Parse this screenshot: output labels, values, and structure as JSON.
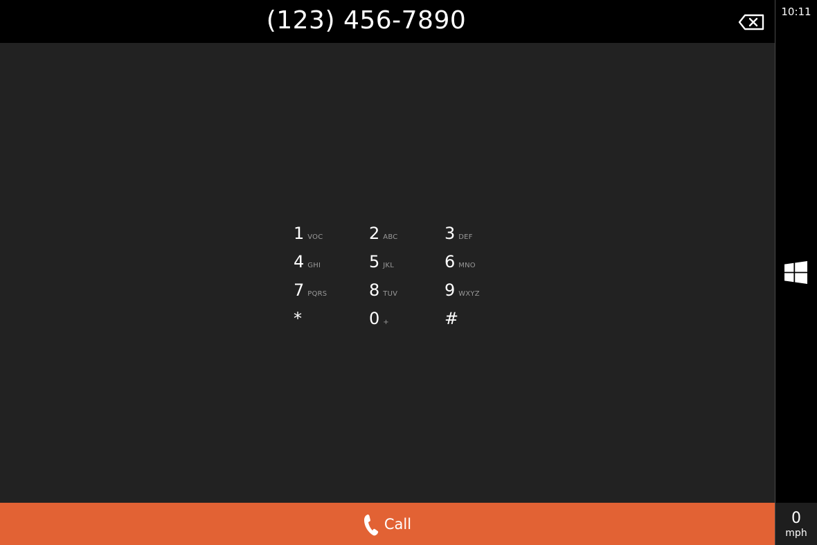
{
  "header": {
    "phone_number": "(123) 456-7890",
    "backspace_icon": "backspace-icon"
  },
  "keypad": {
    "keys": [
      {
        "digit": "1",
        "letters": "VOC"
      },
      {
        "digit": "2",
        "letters": "ABC"
      },
      {
        "digit": "3",
        "letters": "DEF"
      },
      {
        "digit": "4",
        "letters": "GHI"
      },
      {
        "digit": "5",
        "letters": "JKL"
      },
      {
        "digit": "6",
        "letters": "MNO"
      },
      {
        "digit": "7",
        "letters": "PQRS"
      },
      {
        "digit": "8",
        "letters": "TUV"
      },
      {
        "digit": "9",
        "letters": "WXYZ"
      },
      {
        "digit": "*",
        "letters": ""
      },
      {
        "digit": "0",
        "letters": "+"
      },
      {
        "digit": "#",
        "letters": ""
      }
    ]
  },
  "call": {
    "label": "Call",
    "icon": "phone-icon"
  },
  "sidebar": {
    "time": "10:11",
    "start_icon": "windows-logo-icon",
    "speed_value": "0",
    "speed_unit": "mph"
  },
  "colors": {
    "background": "#222222",
    "header": "#000000",
    "accent": "#e26234",
    "secondary_text": "#9a9a9a"
  }
}
